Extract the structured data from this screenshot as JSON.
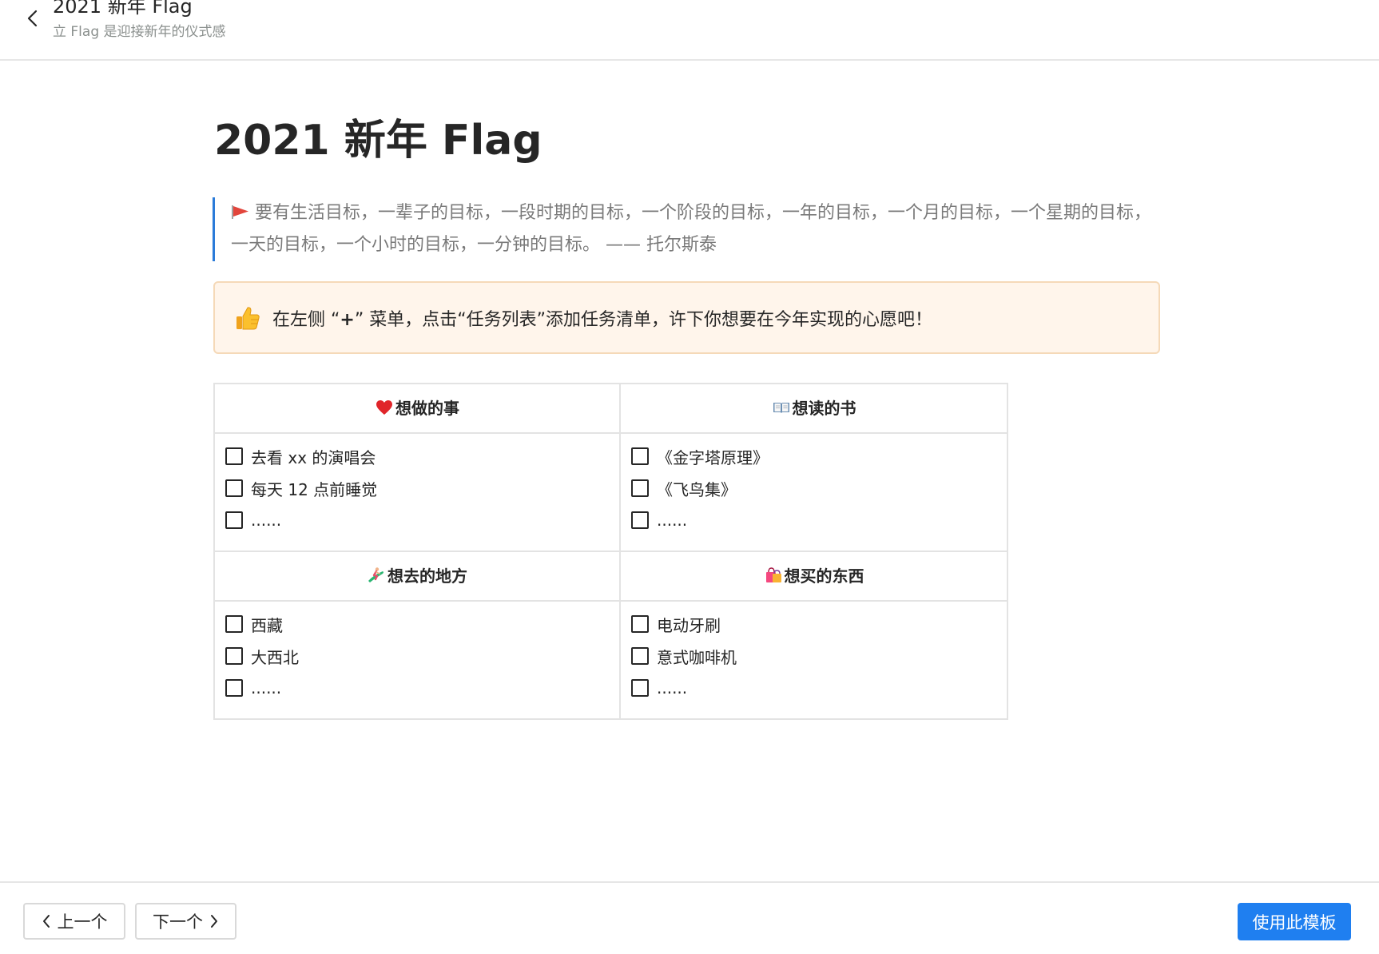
{
  "header": {
    "title": "2021 新年 Flag",
    "subtitle": "立 Flag 是迎接新年的仪式感",
    "back_icon": "chevron-left-icon"
  },
  "document": {
    "title": "2021 新年 Flag",
    "quote": {
      "icon": "red-flag-icon",
      "text": "要有生活目标，一辈子的目标，一段时期的目标，一个阶段的目标，一年的目标，一个月的目标，一个星期的目标，一天的目标，一个小时的目标，一分钟的目标。 —— 托尔斯泰"
    },
    "callout": {
      "icon": "thumbs-up-icon",
      "text_before": "在左侧 “",
      "plus": "+",
      "text_after": "” 菜单，点击“任务列表”添加任务清单，许下你想要在今年实现的心愿吧！",
      "background": "#fff5eb",
      "border": "#f5d9b8"
    },
    "table": {
      "sections": [
        {
          "left": {
            "header": "想做的事",
            "icon": "red-heart-icon",
            "items": [
              "去看 xx 的演唱会",
              "每天 12 点前睡觉",
              "......"
            ]
          },
          "right": {
            "header": "想读的书",
            "icon": "open-book-icon",
            "items": [
              "《金字塔原理》",
              "《飞鸟集》",
              "......"
            ]
          }
        },
        {
          "left": {
            "header": "想去的地方",
            "icon": "surfer-icon",
            "items": [
              "西藏",
              "大西北",
              "......"
            ]
          },
          "right": {
            "header": "想买的东西",
            "icon": "shopping-bags-icon",
            "items": [
              "电动牙刷",
              "意式咖啡机",
              "......"
            ]
          }
        }
      ]
    }
  },
  "footer": {
    "prev_label": "上一个",
    "next_label": "下一个",
    "use_label": "使用此模板",
    "accent": "#1f7ff0"
  }
}
